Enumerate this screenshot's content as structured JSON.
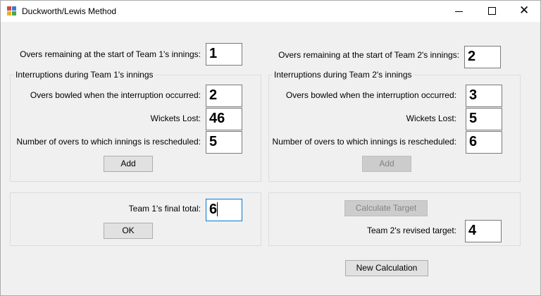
{
  "window": {
    "title": "Duckworth/Lewis Method",
    "icon": "app-window-icon",
    "controls": [
      "minimize-icon",
      "maximize-icon",
      "close-icon"
    ]
  },
  "team1": {
    "overs_label": "Overs remaining at the start of Team 1's innings:",
    "overs_value": "1",
    "group_label": "Interruptions during Team 1's innings",
    "overs_bowled_label": "Overs bowled when the interruption occurred:",
    "overs_bowled_value": "2",
    "wickets_label": "Wickets Lost:",
    "wickets_value": "46",
    "rescheduled_label": "Number of overs to which innings is rescheduled:",
    "rescheduled_value": "5",
    "add_label": "Add",
    "final_total_label": "Team 1's final total:",
    "final_total_value": "6",
    "ok_label": "OK"
  },
  "team2": {
    "overs_label": "Overs remaining at the start of Team 2's innings:",
    "overs_value": "2",
    "group_label": "Interruptions during Team 2's innings",
    "overs_bowled_label": "Overs bowled when the interruption occurred:",
    "overs_bowled_value": "3",
    "wickets_label": "Wickets Lost:",
    "wickets_value": "5",
    "rescheduled_label": "Number of overs to which innings is rescheduled:",
    "rescheduled_value": "6",
    "add_label": "Add",
    "calculate_label": "Calculate Target",
    "revised_target_label": "Team 2's revised target:",
    "revised_target_value": "4"
  },
  "new_calculation_label": "New Calculation",
  "colors": {
    "focus_border": "#0078d7",
    "disabled_text": "#838383"
  }
}
